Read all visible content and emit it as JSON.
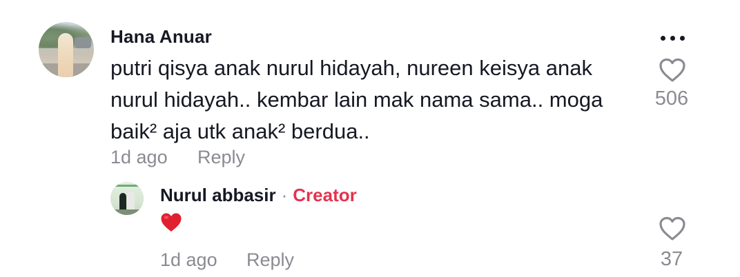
{
  "comment": {
    "username": "Hana Anuar",
    "text": "putri qisya anak nurul hidayah, nureen keisya anak nurul hidayah.. kembar lain mak nama sama.. moga baik² aja utk anak² berdua..",
    "time": "1d ago",
    "reply_label": "Reply",
    "likes": "506"
  },
  "reply": {
    "username": "Nurul abbasir",
    "separator": "·",
    "badge": "Creator",
    "text": "❤️",
    "time": "1d ago",
    "reply_label": "Reply",
    "likes": "37"
  },
  "icons": {
    "more": "more-dots-icon",
    "heart": "heart-outline-icon",
    "emoji": "red-heart-emoji"
  },
  "colors": {
    "text": "#161823",
    "secondary": "#8a8b91",
    "creator": "#e3334f",
    "heart_stroke": "#8a8b91",
    "emoji_heart": "#e0202e"
  }
}
